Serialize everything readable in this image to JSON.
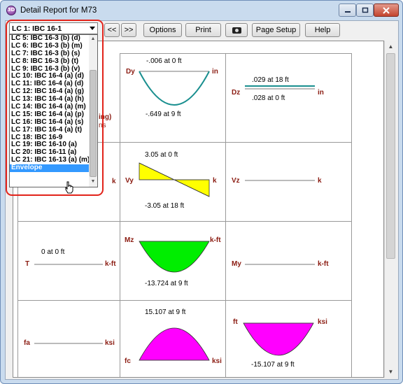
{
  "window": {
    "title": "Detail Report for M73",
    "app_icon_text": "3D"
  },
  "toolbar": {
    "load_combo_value": "LC 1: IBC 16-1",
    "prev_label": "<<",
    "next_label": ">>",
    "options_label": "Options",
    "print_label": "Print",
    "page_setup_label": "Page Setup",
    "help_label": "Help"
  },
  "dropdown": {
    "items": [
      "LC 5: IBC 16-3 (b) (d)",
      "LC 6: IBC 16-3 (b) (m)",
      "LC 7: IBC 16-3 (b) (s)",
      "LC 8: IBC 16-3 (b) (t)",
      "LC 9: IBC 16-3 (b) (v)",
      "LC 10: IBC 16-4 (a) (d)",
      "LC 11: IBC 16-4 (a) (d)",
      "LC 12: IBC 16-4 (a) (g)",
      "LC 13: IBC 16-4 (a) (h)",
      "LC 14: IBC 16-4 (a) (m)",
      "LC 15: IBC 16-4 (a) (p)",
      "LC 16: IBC 16-4 (a) (s)",
      "LC 17: IBC 16-4 (a) (t)",
      "LC 18: IBC 16-9",
      "LC 19: IBC 16-10 (a)",
      "LC 20: IBC 16-11 (a)",
      "LC 21: IBC 16-13 (a) (m)",
      "Envelope"
    ],
    "selected_index": 17
  },
  "report": {
    "partial_text_1": "ing)",
    "partial_text_2": "ns",
    "cells": {
      "dy": {
        "label": "Dy",
        "unit": "in",
        "max": "-.006 at 0 ft",
        "min": "-.649 at 9 ft"
      },
      "dz": {
        "label": "Dz",
        "unit": "in",
        "max": ".029 at 18 ft",
        "min": ".028 at 0 ft"
      },
      "vy": {
        "label": "Vy",
        "unit": "k",
        "max": "3.05 at 0 ft",
        "min": "-3.05 at 18 ft"
      },
      "vz": {
        "label": "Vz",
        "unit": "k"
      },
      "fy_left_unit": {
        "unit": "k"
      },
      "t": {
        "label": "T",
        "unit": "k-ft",
        "max": "0 at 0 ft"
      },
      "mz": {
        "label": "Mz",
        "unit": "k-ft",
        "min": "-13.724 at 9 ft"
      },
      "my": {
        "label": "My",
        "unit": "k-ft"
      },
      "fa": {
        "label": "fa",
        "unit": "ksi"
      },
      "fc": {
        "label": "fc",
        "unit": "ksi",
        "max": "15.107 at 9 ft"
      },
      "ft": {
        "label": "ft",
        "unit": "ksi",
        "min": "-15.107 at 9 ft"
      }
    }
  },
  "colors": {
    "dy_curve": "#1a8f8f",
    "dz_line": "#1a8f8f",
    "vy_fill": "#ffff00",
    "mz_fill": "#00ee00",
    "stress_fill": "#ff00ff",
    "label_red": "#8b1c12",
    "highlight_ring": "#e2231a"
  }
}
